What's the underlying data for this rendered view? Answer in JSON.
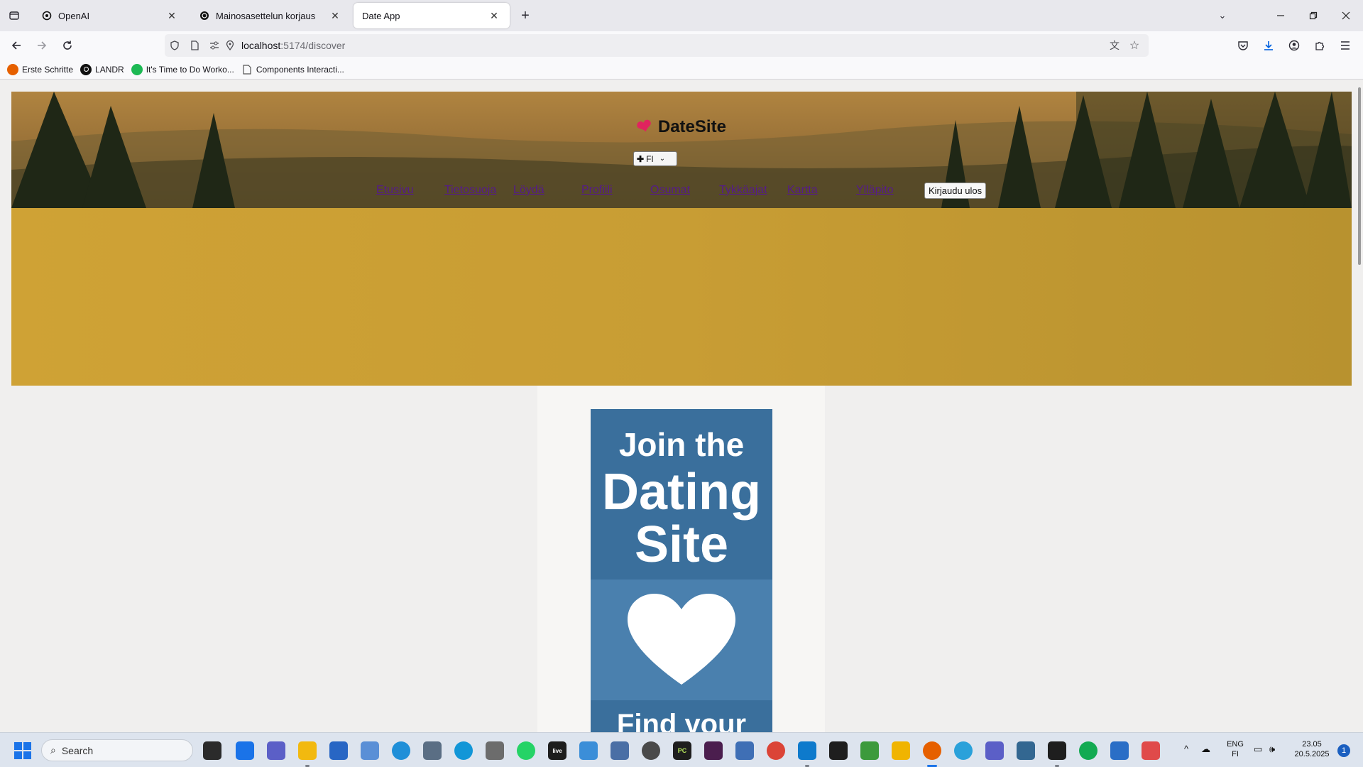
{
  "browser": {
    "tabs": [
      {
        "title": "OpenAI",
        "active": false,
        "favicon": "openai-icon"
      },
      {
        "title": "Mainosasettelun korjaus",
        "active": false,
        "favicon": "openai-icon"
      },
      {
        "title": "Date App",
        "active": true,
        "favicon": ""
      }
    ],
    "url": {
      "host": "localhost",
      "path": ":5174/discover"
    },
    "bookmarks": [
      {
        "label": "Erste Schritte",
        "icon": "firefox-icon",
        "color": "#e66000"
      },
      {
        "label": "LANDR",
        "icon": "landr-icon",
        "color": "#111111"
      },
      {
        "label": "It's Time to Do Worko...",
        "icon": "spotify-icon",
        "color": "#1db954"
      },
      {
        "label": "Components Interacti...",
        "icon": "page-icon",
        "color": "#555555"
      }
    ]
  },
  "site": {
    "brand": "DateSite",
    "language": "FI",
    "nav": [
      "Etusivu",
      "Tietosuoja",
      "Löydä",
      "Profiili",
      "Osumat",
      "Tykkäajat",
      "Kartta",
      "Ylläpito"
    ],
    "logout": "Kirjaudu ulos"
  },
  "ad": {
    "line1": "Join the",
    "line2": "Dating",
    "line3": "Site",
    "bottom": "Find your",
    "colors": {
      "top": "#3a6f9c",
      "middle": "#4a80ae"
    }
  },
  "taskbar": {
    "search_placeholder": "Search",
    "lang_top": "ENG",
    "lang_bottom": "FI",
    "time": "23.05",
    "date": "20.5.2025",
    "notifications": "1"
  }
}
